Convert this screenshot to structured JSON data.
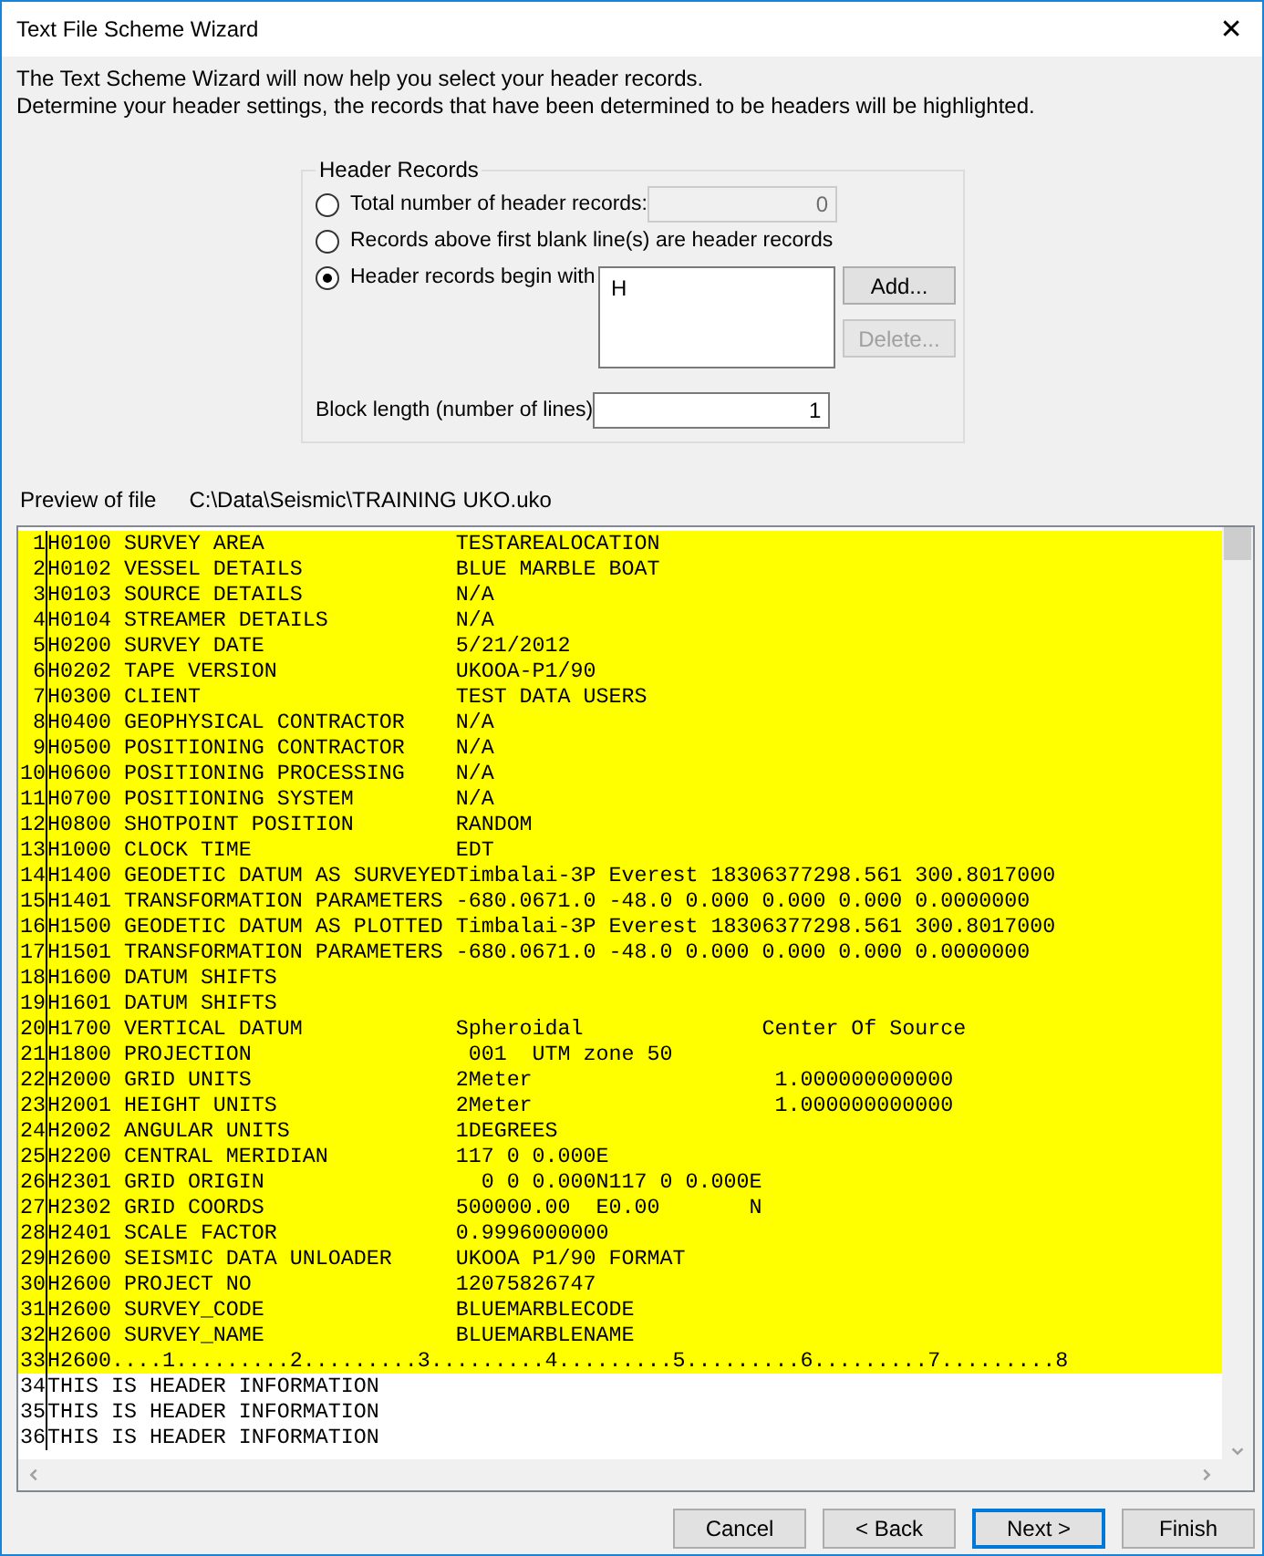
{
  "window": {
    "title": "Text File Scheme Wizard",
    "close": "✕"
  },
  "intro": [
    "The Text Scheme Wizard will now help you select your header records.",
    "Determine your header settings, the records that have been determined to be headers will be highlighted."
  ],
  "header_records": {
    "legend": "Header Records",
    "options": [
      {
        "kind": "count",
        "label": "Total number of header records:",
        "selected": false,
        "value": "0",
        "disabled": true
      },
      {
        "kind": "blank",
        "label": "Records above first blank line(s) are header records",
        "selected": false
      },
      {
        "kind": "prefix",
        "label": "Header records begin with",
        "selected": true,
        "items": [
          "H"
        ]
      }
    ],
    "buttons": [
      {
        "label": "Add...",
        "disabled": false
      },
      {
        "label": "Delete...",
        "disabled": true
      }
    ],
    "block_length": {
      "label": "Block length (number of lines)",
      "value": "1"
    }
  },
  "preview": {
    "label": "Preview of file",
    "path": "C:\\Data\\Seismic\\TRAINING UKO.uko",
    "lines": [
      {
        "number": "1",
        "text": "H0100 SURVEY AREA               TESTAREALOCATION",
        "highlighted": true
      },
      {
        "number": "2",
        "text": "H0102 VESSEL DETAILS            BLUE MARBLE BOAT",
        "highlighted": true
      },
      {
        "number": "3",
        "text": "H0103 SOURCE DETAILS            N/A",
        "highlighted": true
      },
      {
        "number": "4",
        "text": "H0104 STREAMER DETAILS          N/A",
        "highlighted": true
      },
      {
        "number": "5",
        "text": "H0200 SURVEY DATE               5/21/2012",
        "highlighted": true
      },
      {
        "number": "6",
        "text": "H0202 TAPE VERSION              UKOOA-P1/90",
        "highlighted": true
      },
      {
        "number": "7",
        "text": "H0300 CLIENT                    TEST DATA USERS",
        "highlighted": true
      },
      {
        "number": "8",
        "text": "H0400 GEOPHYSICAL CONTRACTOR    N/A",
        "highlighted": true
      },
      {
        "number": "9",
        "text": "H0500 POSITIONING CONTRACTOR    N/A",
        "highlighted": true
      },
      {
        "number": "10",
        "text": "H0600 POSITIONING PROCESSING    N/A",
        "highlighted": true
      },
      {
        "number": "11",
        "text": "H0700 POSITIONING SYSTEM        N/A",
        "highlighted": true
      },
      {
        "number": "12",
        "text": "H0800 SHOTPOINT POSITION        RANDOM",
        "highlighted": true
      },
      {
        "number": "13",
        "text": "H1000 CLOCK TIME                EDT",
        "highlighted": true
      },
      {
        "number": "14",
        "text": "H1400 GEODETIC DATUM AS SURVEYEDTimbalai-3P Everest 18306377298.561 300.8017000",
        "highlighted": true
      },
      {
        "number": "15",
        "text": "H1401 TRANSFORMATION PARAMETERS -680.0671.0 -48.0 0.000 0.000 0.000 0.0000000",
        "highlighted": true
      },
      {
        "number": "16",
        "text": "H1500 GEODETIC DATUM AS PLOTTED Timbalai-3P Everest 18306377298.561 300.8017000",
        "highlighted": true
      },
      {
        "number": "17",
        "text": "H1501 TRANSFORMATION PARAMETERS -680.0671.0 -48.0 0.000 0.000 0.000 0.0000000",
        "highlighted": true
      },
      {
        "number": "18",
        "text": "H1600 DATUM SHIFTS",
        "highlighted": true
      },
      {
        "number": "19",
        "text": "H1601 DATUM SHIFTS",
        "highlighted": true
      },
      {
        "number": "20",
        "text": "H1700 VERTICAL DATUM            Spheroidal              Center Of Source",
        "highlighted": true
      },
      {
        "number": "21",
        "text": "H1800 PROJECTION                 001  UTM zone 50",
        "highlighted": true
      },
      {
        "number": "22",
        "text": "H2000 GRID UNITS                2Meter                   1.000000000000",
        "highlighted": true
      },
      {
        "number": "23",
        "text": "H2001 HEIGHT UNITS              2Meter                   1.000000000000",
        "highlighted": true
      },
      {
        "number": "24",
        "text": "H2002 ANGULAR UNITS             1DEGREES",
        "highlighted": true
      },
      {
        "number": "25",
        "text": "H2200 CENTRAL MERIDIAN          117 0 0.000E",
        "highlighted": true
      },
      {
        "number": "26",
        "text": "H2301 GRID ORIGIN                 0 0 0.000N117 0 0.000E",
        "highlighted": true
      },
      {
        "number": "27",
        "text": "H2302 GRID COORDS               500000.00  E0.00       N",
        "highlighted": true
      },
      {
        "number": "28",
        "text": "H2401 SCALE FACTOR              0.9996000000",
        "highlighted": true
      },
      {
        "number": "29",
        "text": "H2600 SEISMIC DATA UNLOADER     UKOOA P1/90 FORMAT",
        "highlighted": true
      },
      {
        "number": "30",
        "text": "H2600 PROJECT NO                12075826747",
        "highlighted": true
      },
      {
        "number": "31",
        "text": "H2600 SURVEY_CODE               BLUEMARBLECODE",
        "highlighted": true
      },
      {
        "number": "32",
        "text": "H2600 SURVEY_NAME               BLUEMARBLENAME",
        "highlighted": true
      },
      {
        "number": "33",
        "text": "H2600....1.........2.........3.........4.........5.........6.........7.........8",
        "highlighted": true
      },
      {
        "number": "34",
        "text": "THIS IS HEADER INFORMATION",
        "highlighted": false
      },
      {
        "number": "35",
        "text": "THIS IS HEADER INFORMATION",
        "highlighted": false
      },
      {
        "number": "36",
        "text": "THIS IS HEADER INFORMATION",
        "highlighted": false
      }
    ]
  },
  "buttons": [
    {
      "label": "Cancel",
      "default": false
    },
    {
      "label": "< Back",
      "default": false
    },
    {
      "label": "Next >",
      "default": true
    },
    {
      "label": "Finish",
      "default": false
    }
  ]
}
